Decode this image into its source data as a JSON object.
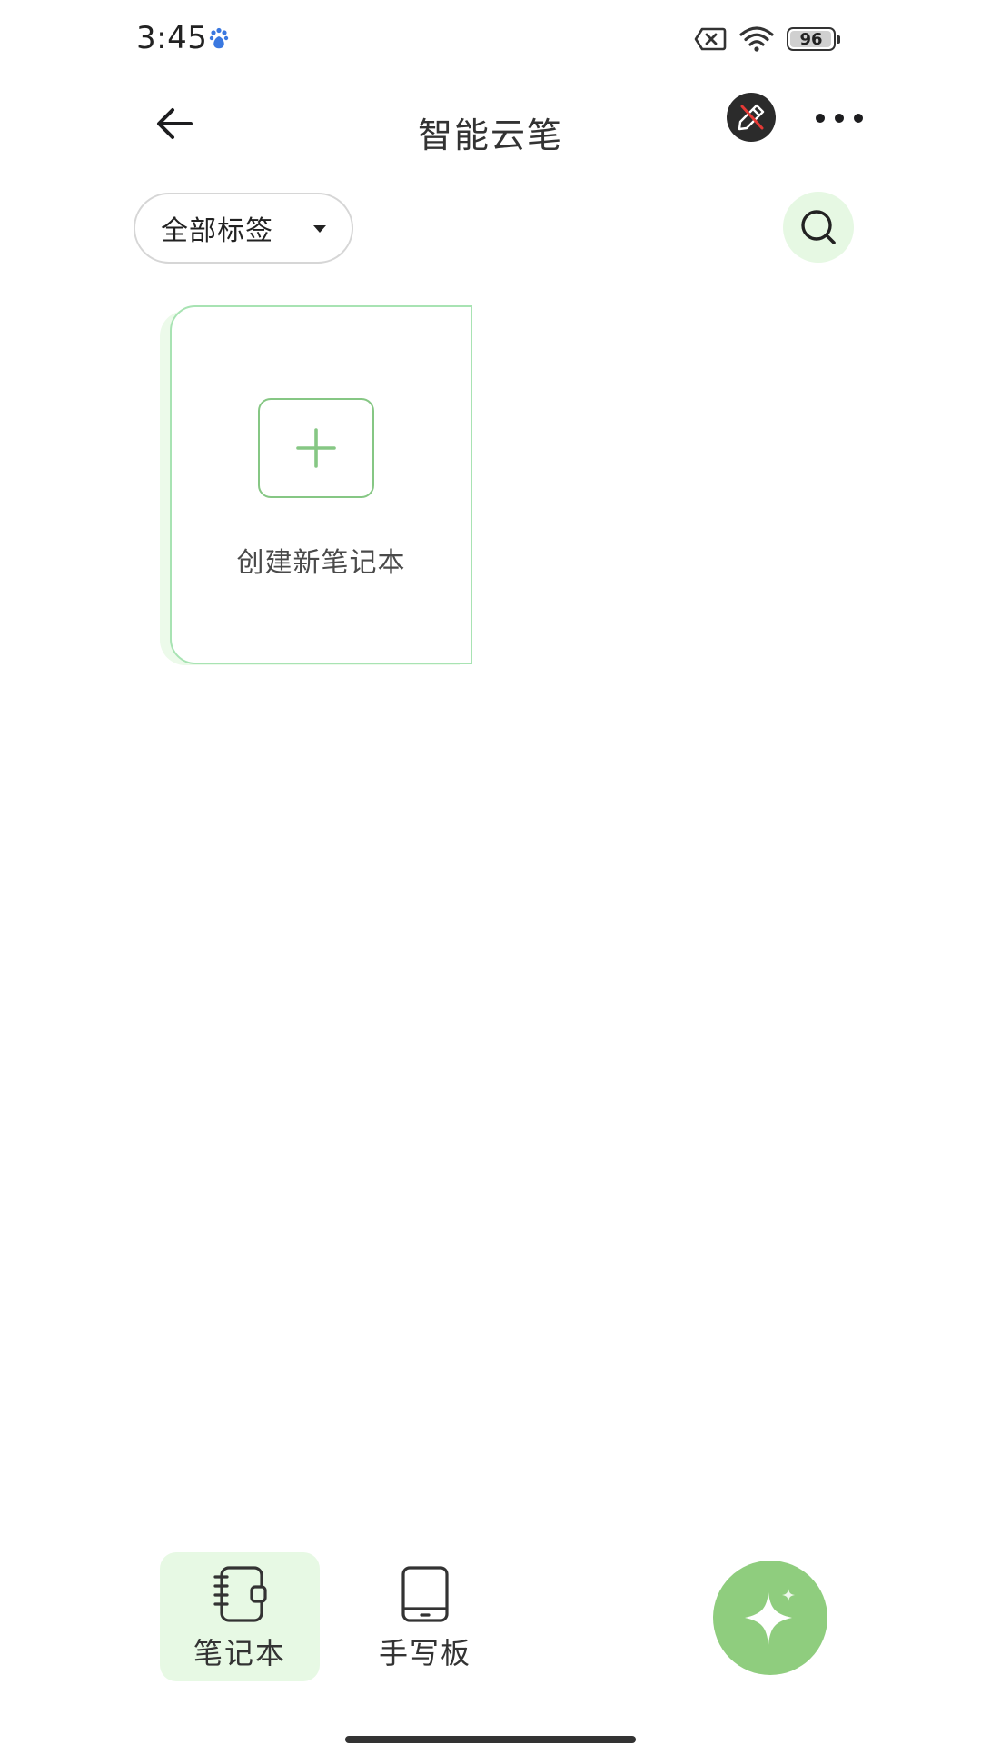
{
  "status_bar": {
    "time": "3:45",
    "battery": "96"
  },
  "header": {
    "title": "智能云笔"
  },
  "filter": {
    "tag_label": "全部标签"
  },
  "create_card": {
    "label": "创建新笔记本"
  },
  "bottom_nav": {
    "notebook_label": "笔记本",
    "handwriting_label": "手写板"
  },
  "icons": {
    "back": "back-arrow-icon",
    "pen_toggle": "pen-disabled-icon",
    "more": "more-dots-icon",
    "search": "search-icon",
    "plus": "plus-icon",
    "notebook": "notebook-icon",
    "tablet": "tablet-icon",
    "ai": "sparkle-icon"
  },
  "colors": {
    "accent_green": "#8fcd7e",
    "accent_light": "#e6f8e3",
    "card_border": "#a8e3b3",
    "pen_toggle_bg": "#2b2b2b",
    "pen_slash": "#e53935"
  }
}
